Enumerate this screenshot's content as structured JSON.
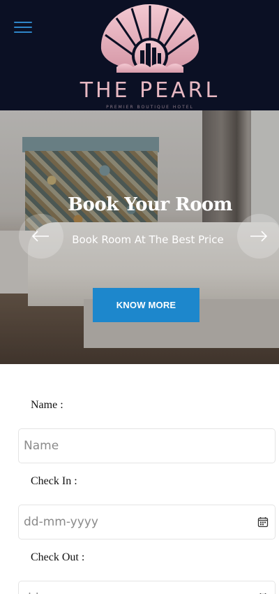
{
  "header": {
    "brand_name": "THE PEARL",
    "brand_tagline": "PREMIER BOUTIQUE HOTEL",
    "menu_icon": "hamburger-menu-icon",
    "logo_icon": "shell-city-logo",
    "background_color": "#0b1024",
    "accent_color": "#2f86c9",
    "logo_color": "#e8b9c3"
  },
  "hero": {
    "title": "Book Your Room",
    "subtitle": "Book Room At The Best Price",
    "cta_label": "KNOW MORE",
    "cta_color": "#1d87cc",
    "prev_icon": "arrow-left-icon",
    "next_icon": "arrow-right-icon"
  },
  "form": {
    "name_label": "Name :",
    "name_placeholder": "Name",
    "checkin_label": "Check In :",
    "checkin_placeholder": "dd-mm-yyyy",
    "checkout_label": "Check Out :",
    "checkout_placeholder": "dd-mm-yyyy",
    "calendar_icon": "calendar-icon"
  }
}
